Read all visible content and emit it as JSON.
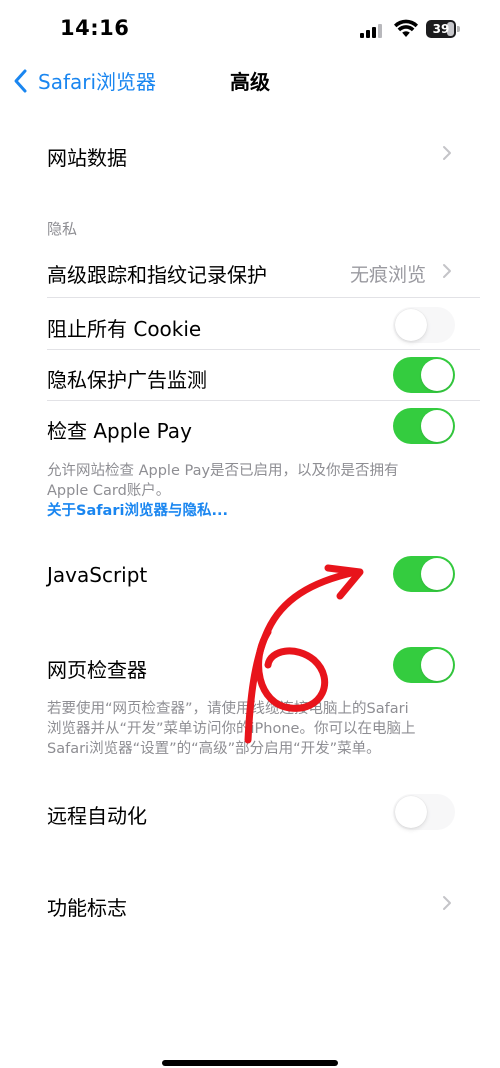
{
  "status_bar": {
    "time": "14:16",
    "battery_level": "39"
  },
  "nav": {
    "back_label": "Safari浏览器",
    "title": "高级"
  },
  "rows": {
    "website_data": "网站数据",
    "privacy_header": "隐私",
    "tracking_protection": {
      "label": "高级跟踪和指纹记录保护",
      "value": "无痕浏览"
    },
    "block_cookies": {
      "label": "阻止所有 Cookie",
      "on": false
    },
    "privacy_ad_measurement": {
      "label": "隐私保护广告监测",
      "on": true
    },
    "check_apple_pay": {
      "label": "检查 Apple Pay",
      "on": true
    },
    "apple_pay_footer_line1": "允许网站检查 Apple Pay是否已启用，以及你是否拥有",
    "apple_pay_footer_line2": "Apple Card账户。",
    "privacy_link": "关于Safari浏览器与隐私...",
    "javascript": {
      "label": "JavaScript",
      "on": true
    },
    "web_inspector": {
      "label": "网页检查器",
      "on": true
    },
    "inspector_footer_line1": "若要使用“网页检查器”，请使用线缆连接电脑上的Safari",
    "inspector_footer_line2": "浏览器并从“开发”菜单访问你的iPhone。你可以在电脑上",
    "inspector_footer_line3": "Safari浏览器“设置”的“高级”部分启用“开发”菜单。",
    "remote_automation": {
      "label": "远程自动化",
      "on": false
    },
    "feature_flags": "功能标志"
  },
  "colors": {
    "accent": "#1a86f0",
    "toggle_on": "#34cc3f",
    "annotation": "#e8141b"
  },
  "icons": [
    "cellular-signal-icon",
    "wifi-icon",
    "battery-icon",
    "chevron-left-icon",
    "chevron-right-icon"
  ]
}
